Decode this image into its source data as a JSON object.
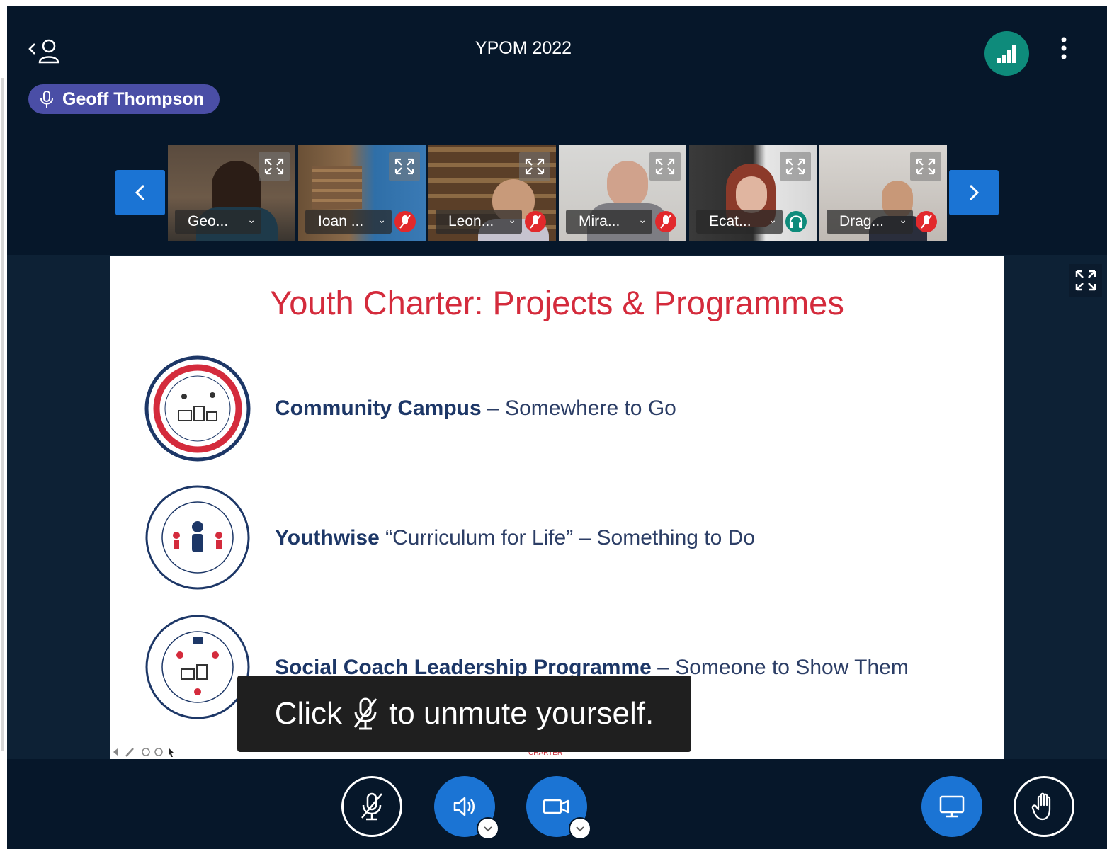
{
  "header": {
    "meeting_title": "YPOM 2022"
  },
  "talker": {
    "name": "Geoff Thompson"
  },
  "video_tiles": [
    {
      "label": "Geo...",
      "status": "speaking"
    },
    {
      "label": "Ioan ...",
      "status": "muted"
    },
    {
      "label": "Leon...",
      "status": "muted"
    },
    {
      "label": "Mira...",
      "status": "muted"
    },
    {
      "label": "Ecat...",
      "status": "listen-only"
    },
    {
      "label": "Drag...",
      "status": "muted"
    }
  ],
  "slide": {
    "title": "Youth Charter: Projects & Programmes",
    "rows": [
      {
        "bold": "Community Campus",
        "rest": " – Somewhere to Go"
      },
      {
        "bold": "Youthwise",
        "rest": " “Curriculum for Life” – Something to Do"
      },
      {
        "bold": "Social Coach Leadership Programme",
        "rest": " – Someone to Show Them"
      }
    ],
    "footer": "CHARTER"
  },
  "toast": {
    "before": "Click",
    "after": "to unmute yourself."
  },
  "colors": {
    "background": "#06172a",
    "accent_blue": "#1b74d4",
    "title_red": "#d42b3c",
    "text_navy": "#1d3767",
    "connection_green": "#0e8b7b",
    "mute_red": "#e2292c",
    "talker_purple": "#4a4ea6"
  },
  "icons": {
    "top_left": "user-list-icon",
    "top_right": [
      "connection-status-icon",
      "more-options-icon"
    ],
    "controls": [
      "microphone-muted-icon",
      "speaker-icon",
      "video-camera-icon",
      "screen-share-icon",
      "raise-hand-icon"
    ]
  }
}
